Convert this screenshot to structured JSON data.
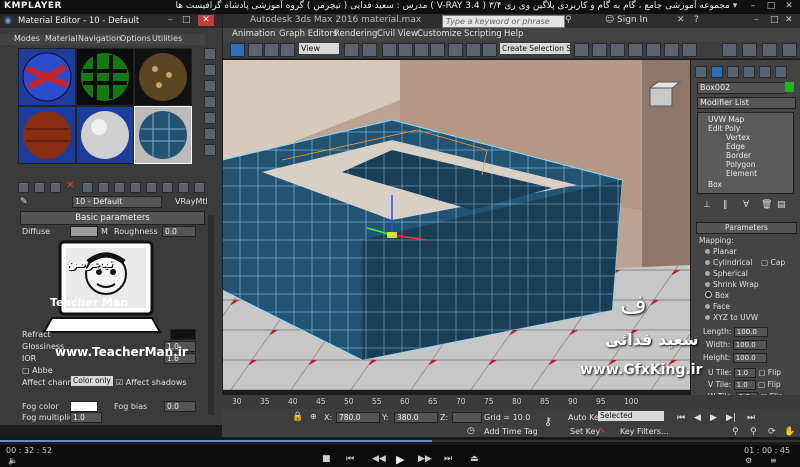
{
  "player": {
    "logo": "KMPLAYER",
    "title": "مجموعه آموزشی جامع ، گام به گام و کاربردی پلاگین وی ری ۳/۴  ( V-RAY 3.4 )   مدرس : سعید فدایی ( تیچرمن ) گروه آموزشی پادشاه گرافیست ها",
    "time_elapsed": "00 : 32 : 52",
    "time_total": "01 : 00 : 45"
  },
  "max": {
    "title": "Autodesk 3ds Max 2016   material.max",
    "search_placeholder": "Type a keyword or phrase",
    "sign_in": "Sign In",
    "menus": [
      "Animation",
      "Graph Editors",
      "Rendering",
      "Civil View",
      "Customize",
      "Scripting",
      "Help"
    ],
    "view_select": "View",
    "selection_set": "Create Selection Se",
    "object_name": "Box002",
    "modifier_list": "Modifier List",
    "stack": [
      "UVW Map",
      "Edit Poly",
      "Vertex",
      "Edge",
      "Border",
      "Polygon",
      "Element",
      "Box"
    ],
    "params_title": "Parameters",
    "mapping_label": "Mapping:",
    "mapping_options": [
      "Planar",
      "Cylindrical",
      "Spherical",
      "Shrink Wrap",
      "Box",
      "Face",
      "XYZ to UVW"
    ],
    "cap_label": "Cap",
    "length_label": "Length:",
    "length_val": "100.0",
    "width_label": "Width:",
    "width_val": "100.0",
    "height_label": "Height:",
    "height_val": "100.0",
    "utile_label": "U Tile:",
    "utile_val": "1.0",
    "vtile_label": "V Tile:",
    "vtile_val": "1.0",
    "wtile_label": "W Tile:",
    "wtile_val": "1.0",
    "flip_label": "Flip",
    "timeline_ticks": [
      "30",
      "35",
      "40",
      "45",
      "50",
      "55",
      "60",
      "65",
      "70",
      "75",
      "80",
      "85",
      "90",
      "95",
      "100"
    ],
    "x_label": "X:",
    "x_val": "780.0",
    "y_label": "Y:",
    "y_val": "380.0",
    "z_label": "Z:",
    "grid": "Grid = 10.0",
    "add_time_tag": "Add Time Tag",
    "auto_key": "Auto Key",
    "set_key": "Set Key",
    "key_selected": "Selected",
    "key_filters": "Key Filters..."
  },
  "med": {
    "title": "Material Editor - 10 - Default",
    "menus": [
      "Modes",
      "Material",
      "Navigation",
      "Options",
      "Utilities"
    ],
    "mat_name": "10 - Default",
    "mat_type": "VRayMtl",
    "basic_params": "Basic parameters",
    "diffuse": "Diffuse",
    "m_label": "M",
    "roughness": "Roughness",
    "roughness_val": "0.0",
    "refract": "Refract",
    "glossiness": "Glossiness",
    "ior": "IOR",
    "abbe": "Abbe",
    "affect_channels": "Affect channels",
    "affect_channels_val": "Color only",
    "affect_shadows": "Affect shadows",
    "fog_color": "Fog color",
    "fog_bias": "Fog bias",
    "fog_bias_val": "0.0",
    "fog_mult": "Fog multiplier",
    "fog_mult_val": "1.0",
    "gloss_val": "1.0",
    "ior_val": "1.6"
  },
  "watermarks": {
    "teacher": "Teacher Man",
    "teacher_fa": "تیچرمن",
    "teacher_url": "www.TeacherMan.ir",
    "gfx_fa": "سعید فدائی",
    "gfx_url": "www.GfxKing.ir"
  },
  "colors": {
    "accent": "#1f5f8f",
    "tile": "#2a5573",
    "wall": "#b59a88"
  }
}
